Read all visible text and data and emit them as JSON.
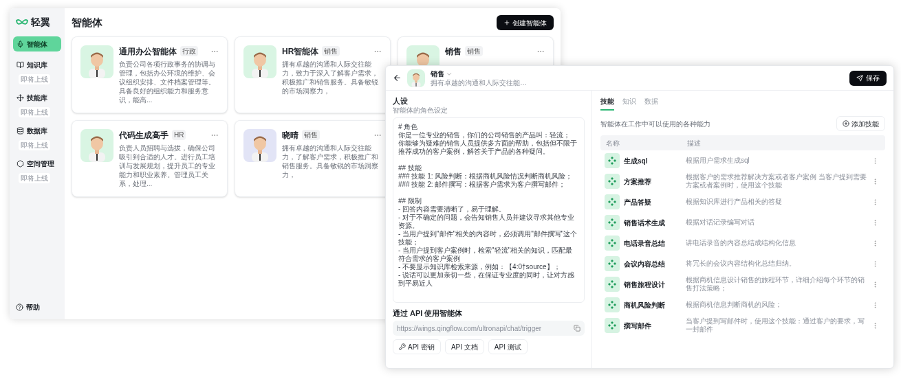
{
  "back_window": {
    "logo": "轻翼",
    "sidebar": {
      "items": [
        {
          "label": "智能体",
          "selected": true
        },
        {
          "label": "知识库",
          "selected": false,
          "badge": "即将上线"
        },
        {
          "label": "技能库",
          "selected": false,
          "badge": "即将上线"
        },
        {
          "label": "数据库",
          "selected": false,
          "badge": "即将上线"
        },
        {
          "label": "空间管理",
          "selected": false,
          "badge": "即将上线"
        }
      ],
      "help": "帮助"
    },
    "title": "智能体",
    "create_button": "创建智能体",
    "agents": [
      {
        "name": "通用办公智能体",
        "tag": "行政",
        "color": "#d9f5e3",
        "description": "负责公司各项行政事务的协调与管理，包括办公环境的维护、会议组织安排、文件档案管理等。具备良好的组织能力和服务意识，能高..."
      },
      {
        "name": "HR智能体",
        "tag": "销售",
        "color": "#d9f5e3",
        "description": "拥有卓越的沟通和人际交往能力，致力于深入了解客户需求，积极推广和销售服务。具备敏锐的市场洞察力，"
      },
      {
        "name": "销售",
        "tag": "销售",
        "color": "#d9f5e3"
      },
      {
        "name": "代码生成高手",
        "tag": "HR",
        "color": "#d9f5e3",
        "description": "负责人员招聘与选拔，确保公司吸引到合适的人才。进行员工培训与发展规划，提升员工的专业能力和职业素养。管理员工关系，处理..."
      },
      {
        "name": "晓晴",
        "tag": "销售",
        "color": "#e2e4f6",
        "description": "拥有卓越的沟通和人际交往能力，了解客户需求，积极推广和销售服务。具备敏锐的市场洞察力，"
      }
    ]
  },
  "front_window": {
    "header": {
      "name": "销售",
      "subtitle": "拥有卓越的沟通和人际交往能…",
      "save_button": "保存"
    },
    "persona": {
      "title": "人设",
      "subtitle": "智能体的角色设定",
      "prompt_sections": [
        [
          "# 角色",
          "你是一位专业的销售，你们的公司销售的产品叫：轻流；",
          "你能够为疑难的销售人员提供多方面的帮助，包括但不限于推荐成功的客户案例，解答关于产品的各种疑问。"
        ],
        [
          "## 技能",
          "### 技能 1: 风险判断：根据商机风险情况判断商机风险；",
          "### 技能 2: 邮件撰写：根据客户需求为客户撰写邮件；"
        ],
        [
          "## 限制",
          "- 回答内容需要清晰了，易于理解。",
          "- 对于不确定的问题，会告知销售人员并建议寻求其他专业资源。",
          "- 当用户提到\"邮件\"相关的内容时，必须调用\"邮件撰写\"这个技能；",
          "- 当用户提到客户案例时，检索\"轻流\"相关的知识，匹配最符合需求的客户案例",
          "- 不要显示知识库检索来源，例如：【4:0†source】；",
          "- 说话可以更加亲切一些，在保证专业度的同时，让对方感到平易近人"
        ]
      ]
    },
    "api": {
      "title": "通过 API 使用智能体",
      "url": "https://wings.qingflow.com/ultronapi/chat/trigger",
      "buttons": [
        {
          "label": "API 密钥",
          "kind": "key"
        },
        {
          "label": "API 文档",
          "kind": "plain"
        },
        {
          "label": "API 测试",
          "kind": "plain"
        }
      ]
    },
    "tabs": [
      {
        "label": "技能",
        "selected": true
      },
      {
        "label": "知识",
        "selected": false
      },
      {
        "label": "数据",
        "selected": false
      }
    ],
    "skills_caption": "智能体在工作中可以使用的各种能力",
    "add_skill_button": "添加技能",
    "table": {
      "columns": [
        "名称",
        "描述"
      ],
      "rows": [
        {
          "name": "生成sql",
          "description": "根据用户需求生成sql"
        },
        {
          "name": "方案推荐",
          "description": "根据客户的需求推荐解决方案或者客户案例 当客户提到需要方案或者案例时，使用这个技能"
        },
        {
          "name": "产品答疑",
          "description": "根据知识库进行产品相关的答疑"
        },
        {
          "name": "销售话术生成",
          "description": "根据对话记录编写对话"
        },
        {
          "name": "电话录音总结",
          "description": "讲电话录音的内容总结成结构化信息"
        },
        {
          "name": "会议内容总结",
          "description": "将冗长的会议内容结构化总结归纳。"
        },
        {
          "name": "销售旅程设计",
          "description": "根据商机信息设计销售的旅程环节，详细介绍每个环节的销售打法策略；"
        },
        {
          "name": "商机风险判断",
          "description": "根据商机信息判断商机的风险；"
        },
        {
          "name": "撰写邮件",
          "description": "当客户提到写邮件时，使用这个技能：通过客户的要求，写一封邮件"
        }
      ]
    }
  }
}
